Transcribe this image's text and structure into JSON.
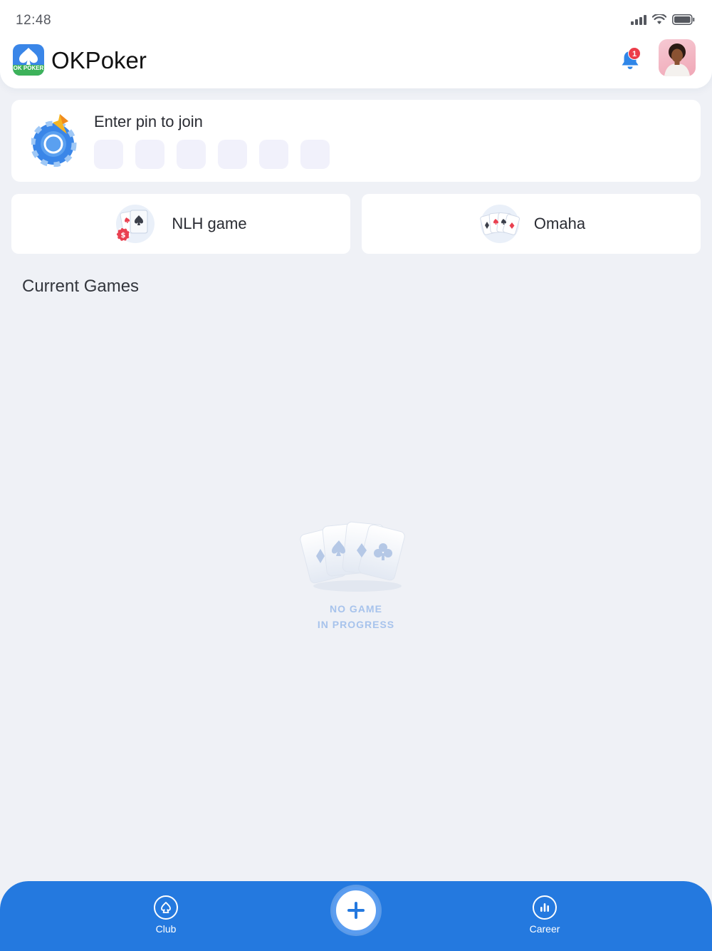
{
  "status_bar": {
    "time": "12:48"
  },
  "header": {
    "app_title": "OKPoker",
    "logo_badge": "OK POKER",
    "notification_count": "1"
  },
  "pin": {
    "title": "Enter pin to join",
    "digits": [
      "",
      "",
      "",
      "",
      "",
      ""
    ]
  },
  "games": [
    {
      "label": "NLH game",
      "icon": "nlh-cards-icon"
    },
    {
      "label": "Omaha",
      "icon": "omaha-cards-icon"
    }
  ],
  "current_games": {
    "title": "Current Games",
    "empty_line1": "NO GAME",
    "empty_line2": "IN PROGRESS"
  },
  "bottom_nav": {
    "club_label": "Club",
    "career_label": "Career",
    "add_icon": "plus-icon"
  },
  "colors": {
    "accent": "#2479df",
    "background": "#eff1f6",
    "badge": "#ec3d49",
    "empty_text": "#a7c3ec"
  }
}
